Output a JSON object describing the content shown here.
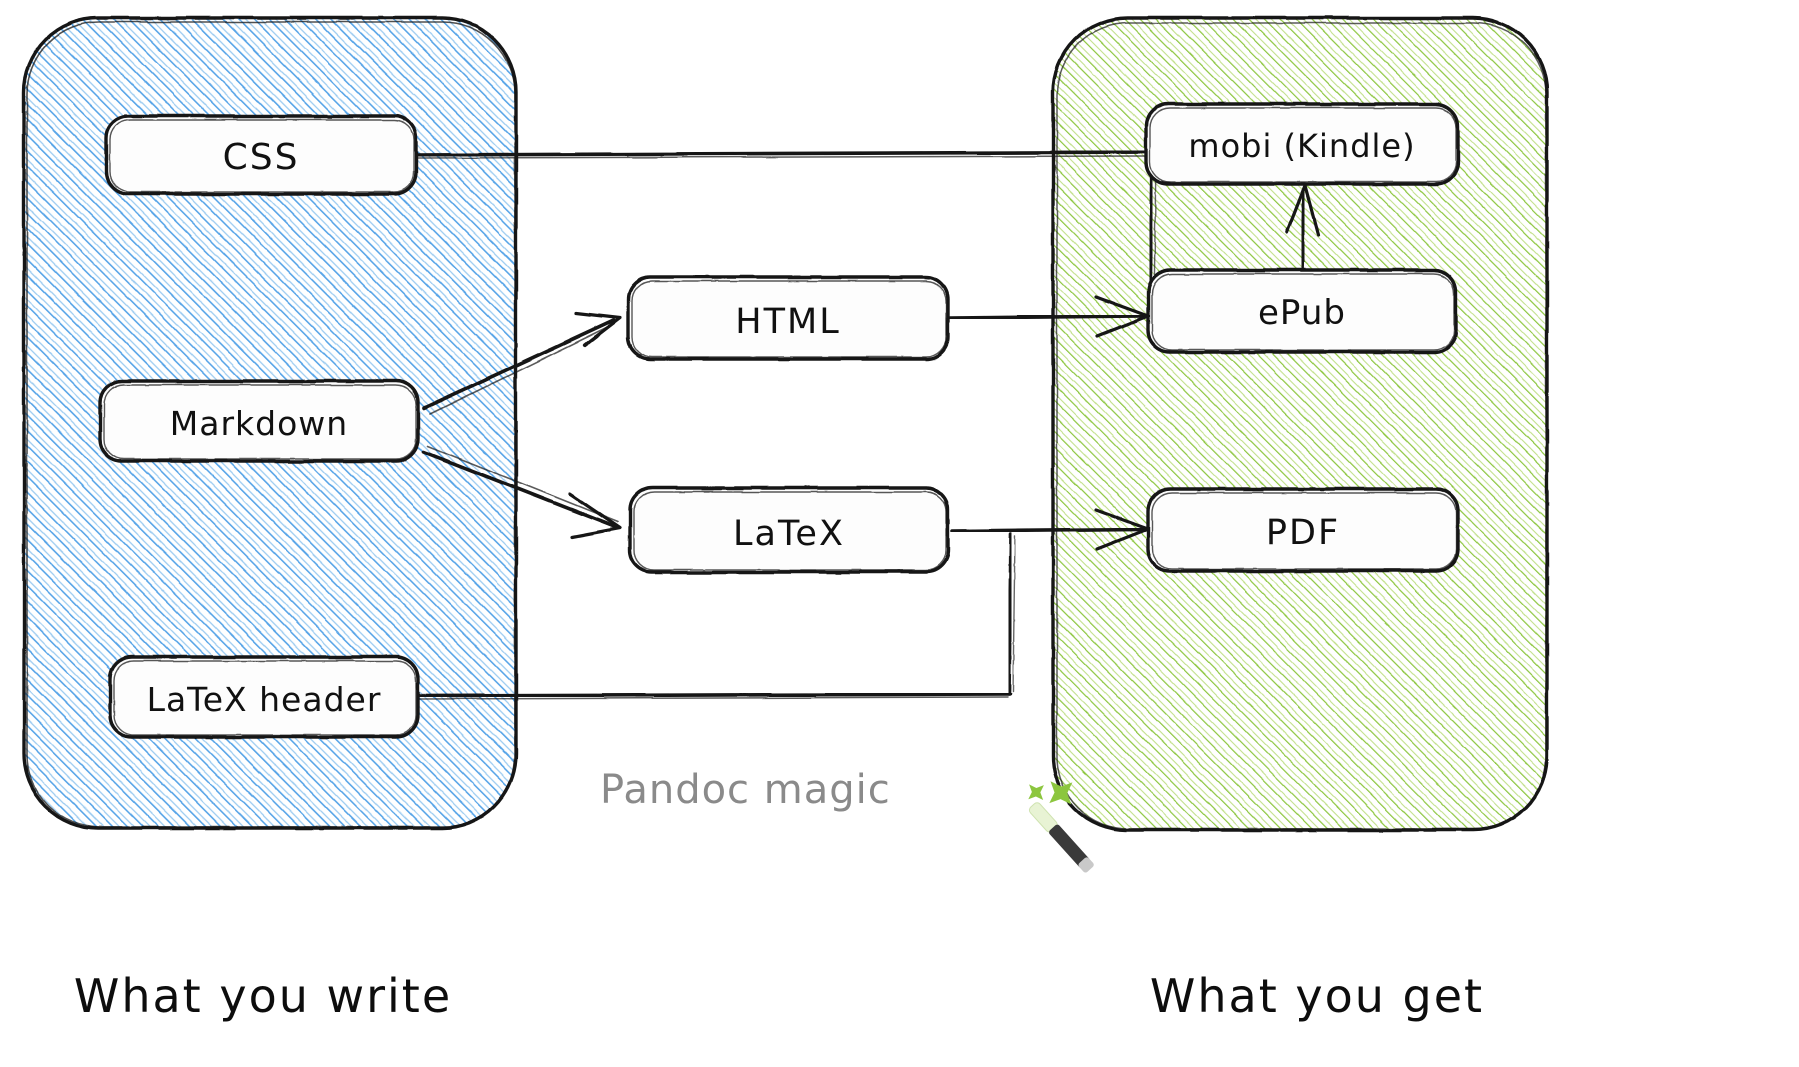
{
  "diagram": {
    "title_visible": false,
    "caption": {
      "text": "Pandoc magic",
      "icon": "magic-wand-icon",
      "icon_glyph": "🪄",
      "color": "#8a8a8a"
    },
    "groups": [
      {
        "id": "input-group",
        "label": "What you write",
        "fill_color": "#5aa2e0",
        "stroke_color": "#1f1f1f",
        "nodes": [
          {
            "id": "css",
            "label": "CSS"
          },
          {
            "id": "markdown",
            "label": "Markdown"
          },
          {
            "id": "latex-header",
            "label": "LaTeX header"
          }
        ]
      },
      {
        "id": "intermediate-group",
        "label": "",
        "fill_color": "#ffffff",
        "stroke_color": "#1f1f1f",
        "nodes": [
          {
            "id": "html",
            "label": "HTML"
          },
          {
            "id": "latex",
            "label": "LaTeX"
          }
        ]
      },
      {
        "id": "output-group",
        "label": "What you get",
        "fill_color": "#8dc63f",
        "stroke_color": "#1f1f1f",
        "nodes": [
          {
            "id": "mobi",
            "label": "mobi (Kindle)"
          },
          {
            "id": "epub",
            "label": "ePub"
          },
          {
            "id": "pdf",
            "label": "PDF"
          }
        ]
      }
    ],
    "edges": [
      {
        "id": "edge-markdown-html",
        "from": "markdown",
        "to": "html",
        "label": ""
      },
      {
        "id": "edge-markdown-latex",
        "from": "markdown",
        "to": "latex",
        "label": ""
      },
      {
        "id": "edge-html-epub",
        "from": "html",
        "to": "epub",
        "label": ""
      },
      {
        "id": "edge-latex-pdf",
        "from": "latex",
        "to": "pdf",
        "label": ""
      },
      {
        "id": "edge-css-epub",
        "from": "css",
        "to": "epub",
        "label": ""
      },
      {
        "id": "edge-latexheader-pdf",
        "from": "latex-header",
        "to": "pdf",
        "label": ""
      },
      {
        "id": "edge-epub-mobi",
        "from": "epub",
        "to": "mobi",
        "label": ""
      }
    ]
  },
  "labels": {
    "css": "CSS",
    "markdown": "Markdown",
    "latex_header": "LaTeX header",
    "html": "HTML",
    "latex": "LaTeX",
    "mobi": "mobi (Kindle)",
    "epub": "ePub",
    "pdf": "PDF",
    "what_you_write": "What you write",
    "what_you_get": "What you get",
    "pandoc_magic": "Pandoc magic",
    "wand": "🪄"
  },
  "colors": {
    "blue_hatch": "#58a5e8",
    "green_hatch": "#8cc63e",
    "ink": "#161616",
    "caption_gray": "#8a8a8a",
    "background": "#ffffff"
  }
}
